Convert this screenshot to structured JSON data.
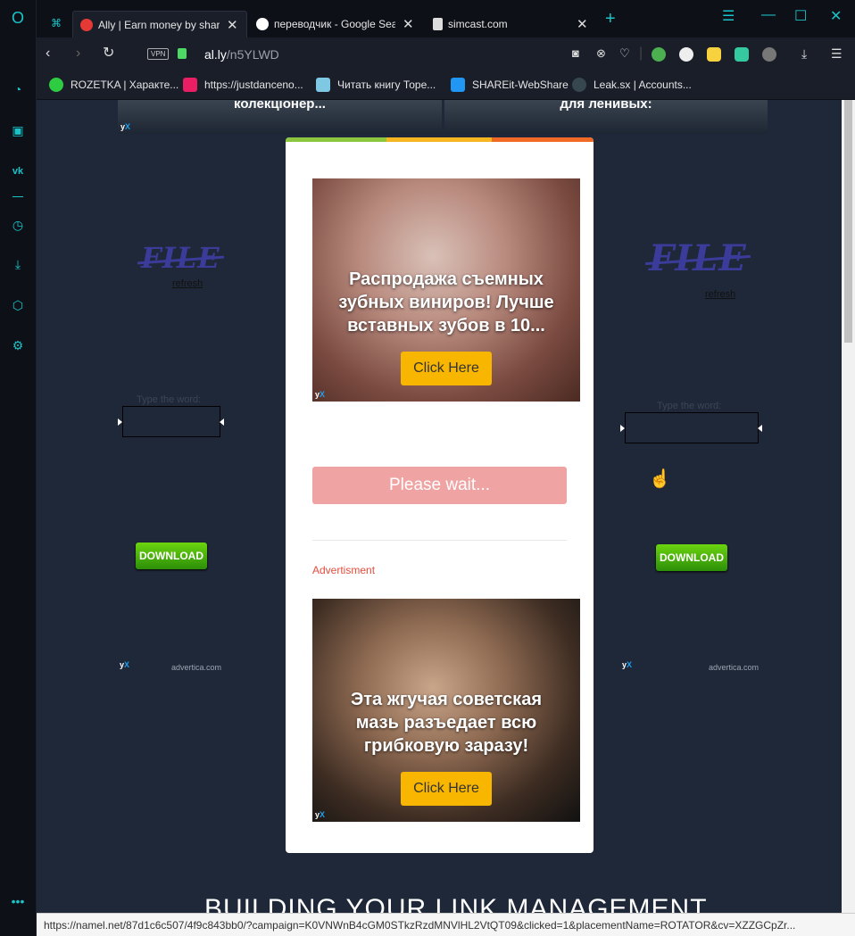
{
  "tabs": [
    {
      "title": "Ally | Earn money by sharin",
      "active": true,
      "icon_color": "#e53935"
    },
    {
      "title": "переводчик - Google Searc",
      "active": false,
      "icon_color": "#ffffff"
    },
    {
      "title": "simcast.com",
      "active": false,
      "icon_color": "#ffffff"
    }
  ],
  "tab_close": "✕",
  "new_tab": "+",
  "window_controls": {
    "minimize": "—",
    "maximize": "☐",
    "close": "✕",
    "easy_setup": "☰"
  },
  "address": {
    "vpn_label": "VPN",
    "url_host": "al.ly",
    "url_path": "/n5YLWD"
  },
  "bookmarks": [
    {
      "label": "ROZETKA | Характе...",
      "icon_color": "#2ecc40"
    },
    {
      "label": "https://justdanceno...",
      "icon_color": "#e91e63"
    },
    {
      "label": "Читать книгу Торе...",
      "icon_color": "#7ec8e3"
    },
    {
      "label": "SHAREit-WebShare",
      "icon_color": "#2196f3"
    },
    {
      "label": "Leak.sx | Accounts...",
      "icon_color": "#37474f"
    }
  ],
  "page": {
    "top_ads": [
      {
        "text": "колекціонер..."
      },
      {
        "text": "для ленивых:"
      }
    ],
    "yx_logo": "yX",
    "left_widget": {
      "logo": "FILE",
      "refresh": "refresh",
      "type_word": "Type the word:",
      "download": "DOWNLOAD",
      "advertica": "advertica.com"
    },
    "right_widget": {
      "logo": "FILE",
      "refresh": "refresh",
      "type_word": "Type the word:",
      "download": "DOWNLOAD",
      "advertica": "advertica.com"
    },
    "modal": {
      "ad1": {
        "text": "Распродажа съемных зубных виниров! Лучше вставных зубов в 10...",
        "cta": "Click Here"
      },
      "wait_button": "Please wait...",
      "advertisement_label": "Advertisment",
      "ad2": {
        "text": "Эта жгучая советская мазь разъедает всю грибковую заразу!",
        "cta": "Click Here"
      }
    },
    "bottom_heading": "BUILDING YOUR LINK MANAGEMENT"
  },
  "status_url": "https://namel.net/87d1c6c507/4f9c843bb0/?campaign=K0VNWnB4cGM0STkzRzdMNVlHL2VtQT09&clicked=1&placementName=ROTATOR&cv=XZZGCpZr...",
  "colors": {
    "accent": "#19c4c8",
    "page_bg": "#1f2838",
    "cta": "#f8b600",
    "wait_btn": "#f0a3a3",
    "download_green": "#3fae0c"
  }
}
